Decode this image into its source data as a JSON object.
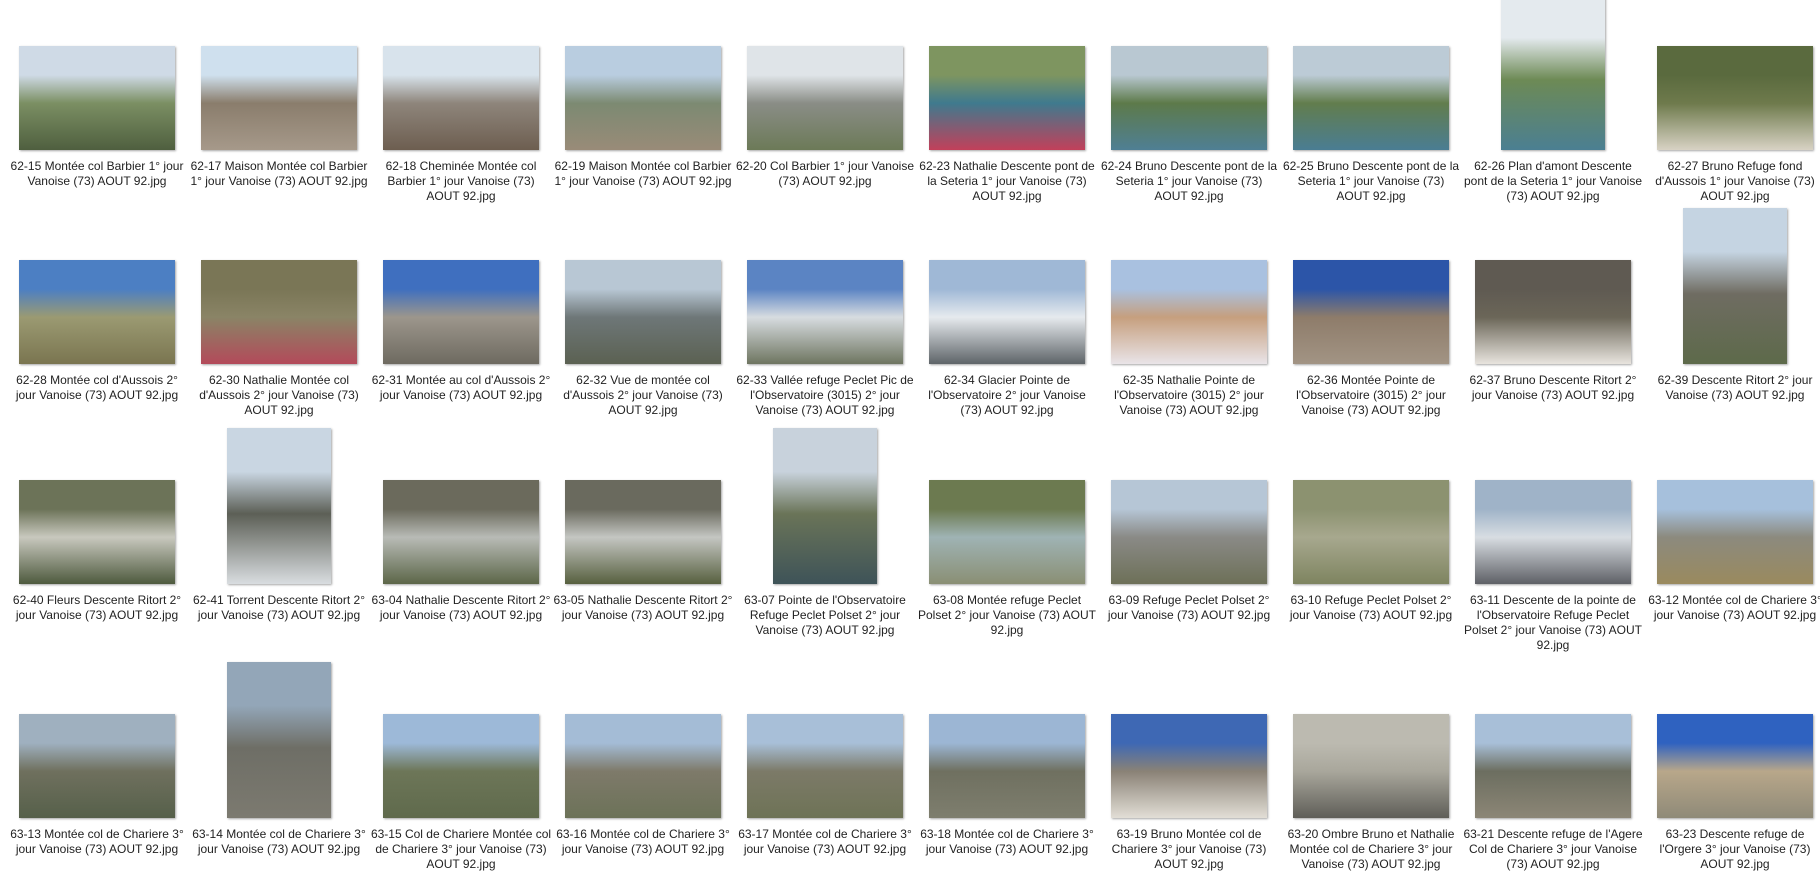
{
  "items": [
    {
      "caption": "62-15 Montée col Barbier 1° jour Vanoise (73) AOUT 92.jpg",
      "orientation": "landscape",
      "colors": [
        "#cfdae6",
        "#7b8f63",
        "#4f5f3f"
      ]
    },
    {
      "caption": "62-17 Maison Montée col Barbier 1° jour Vanoise (73) AOUT 92.jpg",
      "orientation": "landscape",
      "colors": [
        "#cfe0ee",
        "#8a7d6c",
        "#a6998a"
      ]
    },
    {
      "caption": "62-18 Cheminée Montée col Barbier 1° jour Vanoise (73) AOUT 92.jpg",
      "orientation": "landscape",
      "colors": [
        "#d8e3ec",
        "#8e857b",
        "#6d5e50"
      ]
    },
    {
      "caption": "62-19 Maison Montée col Barbier 1° jour Vanoise (73) AOUT 92.jpg",
      "orientation": "landscape",
      "colors": [
        "#b9cde0",
        "#7c8a72",
        "#998b78"
      ]
    },
    {
      "caption": "62-20 Col Barbier 1° jour Vanoise (73) AOUT 92.jpg",
      "orientation": "landscape",
      "colors": [
        "#dfe4e8",
        "#8a8d86",
        "#6c7a58"
      ]
    },
    {
      "caption": "62-23 Nathalie Descente pont de la Seteria 1° jour Vanoise (73) AOUT 92.jpg",
      "orientation": "landscape",
      "colors": [
        "#7e9560",
        "#3f7a8e",
        "#c2405a"
      ]
    },
    {
      "caption": "62-24 Bruno Descente pont de la Seteria 1° jour Vanoise (73) AOUT 92.jpg",
      "orientation": "landscape",
      "colors": [
        "#b9c8d2",
        "#5d7a4a",
        "#4f7f94"
      ]
    },
    {
      "caption": "62-25 Bruno Descente pont de la Seteria 1° jour Vanoise (73) AOUT 92.jpg",
      "orientation": "landscape",
      "colors": [
        "#bccbd6",
        "#627d4d",
        "#4a7d93"
      ]
    },
    {
      "caption": "62-26 Plan d'amont Descente pont de la Seteria 1° jour Vanoise (73) AOUT 92.jpg",
      "orientation": "portrait",
      "colors": [
        "#e4eaee",
        "#6d8a55",
        "#4b7f92"
      ]
    },
    {
      "caption": "62-27 Bruno Refuge fond d'Aussois 1° jour Vanoise (73) AOUT 92.jpg",
      "orientation": "landscape",
      "colors": [
        "#5a6a3e",
        "#6e7a4c",
        "#d8d2c4"
      ]
    },
    {
      "caption": "62-28 Montée col d'Aussois 2° jour Vanoise (73) AOUT 92.jpg",
      "orientation": "landscape",
      "colors": [
        "#4c7fc3",
        "#9b9a72",
        "#7a7550"
      ]
    },
    {
      "caption": "62-30 Nathalie Montée col d'Aussois 2° jour Vanoise (73) AOUT 92.jpg",
      "orientation": "landscape",
      "colors": [
        "#7a7656",
        "#8a8466",
        "#b34a5a"
      ]
    },
    {
      "caption": "62-31 Montée au col d'Aussois 2° jour Vanoise (73) AOUT 92.jpg",
      "orientation": "landscape",
      "colors": [
        "#3f6fbf",
        "#9c968c",
        "#6e6a60"
      ]
    },
    {
      "caption": "62-32 Vue de montée col d'Aussois 2° jour Vanoise (73) AOUT 92.jpg",
      "orientation": "landscape",
      "colors": [
        "#b8c7d4",
        "#6e7778",
        "#5b6152"
      ]
    },
    {
      "caption": "62-33 Vallée refuge Peclet Pic de l'Observatoire (3015) 2° jour Vanoise (73) AOUT 92.jpg",
      "orientation": "landscape",
      "colors": [
        "#5b84c3",
        "#d7dce0",
        "#6e7560"
      ]
    },
    {
      "caption": "62-34 Glacier Pointe de l'Observatoire 2° jour Vanoise (73) AOUT 92.jpg",
      "orientation": "landscape",
      "colors": [
        "#9fb8d6",
        "#e6eaee",
        "#5e6468"
      ]
    },
    {
      "caption": "62-35 Nathalie Pointe de l'Observatoire (3015) 2° jour Vanoise (73) AOUT 92.jpg",
      "orientation": "landscape",
      "colors": [
        "#a9c1e0",
        "#c69f7e",
        "#e9e4e8"
      ]
    },
    {
      "caption": "62-36 Montée Pointe de l'Observatoire (3015) 2° jour Vanoise (73) AOUT 92.jpg",
      "orientation": "landscape",
      "colors": [
        "#2c55a8",
        "#8e7c6a",
        "#a29484"
      ]
    },
    {
      "caption": "62-37 Bruno Descente Ritort 2° jour Vanoise (73) AOUT 92.jpg",
      "orientation": "landscape",
      "colors": [
        "#5f5a52",
        "#6b6658",
        "#e8e4de"
      ]
    },
    {
      "caption": "62-39 Descente Ritort 2° jour Vanoise (73) AOUT 92.jpg",
      "orientation": "portrait",
      "colors": [
        "#c5d4e2",
        "#6f6c62",
        "#5d6a4a"
      ]
    },
    {
      "caption": "62-40 Fleurs Descente Ritort 2° jour Vanoise (73) AOUT 92.jpg",
      "orientation": "landscape",
      "colors": [
        "#6c7358",
        "#c8c8be",
        "#4e5a3e"
      ]
    },
    {
      "caption": "62-41 Torrent Descente Ritort 2° jour Vanoise (73) AOUT 92.jpg",
      "orientation": "portrait",
      "colors": [
        "#c9d6e2",
        "#5c5f56",
        "#d9dde0"
      ]
    },
    {
      "caption": "63-04 Nathalie Descente Ritort 2° jour Vanoise (73) AOUT 92.jpg",
      "orientation": "landscape",
      "colors": [
        "#6b6a5c",
        "#b8bbb6",
        "#5c6648"
      ]
    },
    {
      "caption": "63-05 Nathalie Descente Ritort 2° jour Vanoise (73) AOUT 92.jpg",
      "orientation": "landscape",
      "colors": [
        "#6a6a5e",
        "#c4c6c2",
        "#57603f"
      ]
    },
    {
      "caption": "63-07 Pointe de l'Observatoire Refuge Peclet Polset 2° jour Vanoise (73) AOUT 92.jpg",
      "orientation": "portrait",
      "colors": [
        "#c8d2dc",
        "#6a7458",
        "#3e5358"
      ]
    },
    {
      "caption": "63-08 Montée refuge Peclet Polset 2° jour Vanoise (73) AOUT 92.jpg",
      "orientation": "landscape",
      "colors": [
        "#6c7a50",
        "#9fb3b4",
        "#8a8f74"
      ]
    },
    {
      "caption": "63-09 Refuge Peclet Polset 2° jour Vanoise (73) AOUT 92.jpg",
      "orientation": "landscape",
      "colors": [
        "#b6c6d6",
        "#8a8a86",
        "#6d7058"
      ]
    },
    {
      "caption": "63-10 Refuge Peclet Polset 2° jour Vanoise (73) AOUT 92.jpg",
      "orientation": "landscape",
      "colors": [
        "#8c9270",
        "#a7a88e",
        "#7e8460"
      ]
    },
    {
      "caption": "63-11 Descente de la pointe de l'Observatoire Refuge Peclet Polset 2° jour Vanoise (73) AOUT 92.jpg",
      "orientation": "landscape",
      "colors": [
        "#9fb3c8",
        "#d8dde2",
        "#5e6066"
      ]
    },
    {
      "caption": "63-12 Montée col de Chariere 3° jour Vanoise (73) AOUT 92.jpg",
      "orientation": "landscape",
      "colors": [
        "#a6c0dc",
        "#8c8a7e",
        "#9a8a5e"
      ]
    },
    {
      "caption": "63-13 Montée col de Chariere 3° jour Vanoise (73) AOUT 92.jpg",
      "orientation": "landscape",
      "colors": [
        "#9fb0bf",
        "#6f705e",
        "#56604a"
      ]
    },
    {
      "caption": "63-14 Montée col de Chariere 3° jour Vanoise (73) AOUT 92.jpg",
      "orientation": "portrait",
      "colors": [
        "#93a6b8",
        "#6e6e66",
        "#7c7a70"
      ]
    },
    {
      "caption": "63-15 Col de Chariere Montée col de Chariere 3° jour Vanoise (73) AOUT 92.jpg",
      "orientation": "landscape",
      "colors": [
        "#9db9d8",
        "#6d7658",
        "#5f6a4c"
      ]
    },
    {
      "caption": "63-16 Montée col de Chariere 3° jour Vanoise (73) AOUT 92.jpg",
      "orientation": "landscape",
      "colors": [
        "#a4bcd6",
        "#7e7a6a",
        "#6c7258"
      ]
    },
    {
      "caption": "63-17 Montée col de Chariere 3° jour Vanoise (73) AOUT 92.jpg",
      "orientation": "landscape",
      "colors": [
        "#a8bfd8",
        "#7c7a68",
        "#6e7356"
      ]
    },
    {
      "caption": "63-18 Montée col de Chariere 3° jour Vanoise (73) AOUT 92.jpg",
      "orientation": "landscape",
      "colors": [
        "#9cb6d4",
        "#6f7060",
        "#7e7e6e"
      ]
    },
    {
      "caption": "63-19 Bruno Montée col de Chariere 3° jour Vanoise (73) AOUT 92.jpg",
      "orientation": "landscape",
      "colors": [
        "#3e68b4",
        "#8a8276",
        "#e2ded6"
      ]
    },
    {
      "caption": "63-20 Ombre Bruno et Nathalie Montée col de Chariere 3° jour Vanoise (73) AOUT 92.jpg",
      "orientation": "landscape",
      "colors": [
        "#bcbab0",
        "#a9a79c",
        "#5f5e58"
      ]
    },
    {
      "caption": "63-21 Descente refuge de l'Agere Col de Chariere 3° jour Vanoise (73) AOUT 92.jpg",
      "orientation": "landscape",
      "colors": [
        "#a8bfd8",
        "#6c6e60",
        "#8c8676"
      ]
    },
    {
      "caption": "63-23 Descente refuge de l'Orgere 3° jour Vanoise (73) AOUT 92.jpg",
      "orientation": "landscape",
      "colors": [
        "#2f62c0",
        "#b8a78a",
        "#8f8a78"
      ]
    }
  ]
}
